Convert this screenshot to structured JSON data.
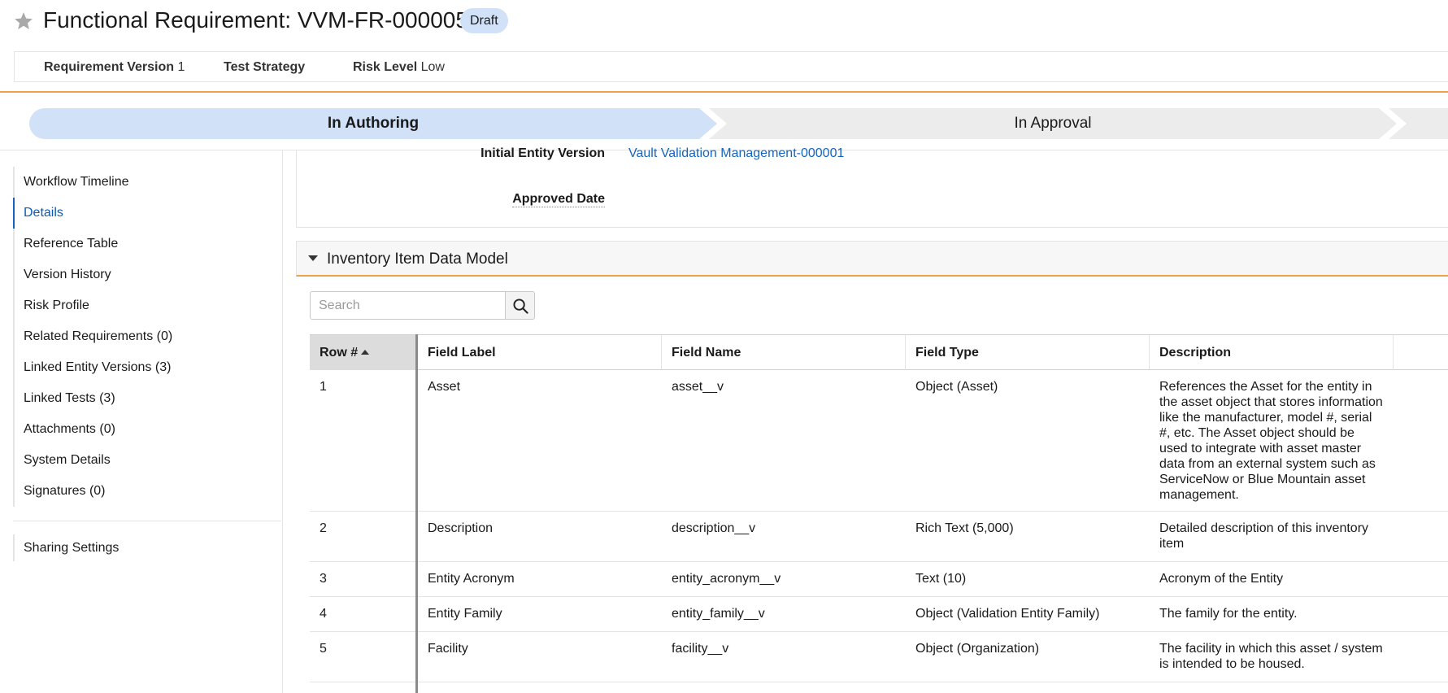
{
  "header": {
    "title": "Functional Requirement: VVM-FR-000005",
    "status_badge": "Draft",
    "star_icon": "star-icon"
  },
  "attributes": [
    {
      "label": "Requirement Version",
      "value": "1"
    },
    {
      "label": "Test Strategy",
      "value": ""
    },
    {
      "label": "Risk Level",
      "value": "Low"
    }
  ],
  "workflow": {
    "stages": [
      {
        "label": "In Authoring",
        "active": true
      },
      {
        "label": "In Approval",
        "active": false
      }
    ]
  },
  "sidebar": {
    "items": [
      {
        "label": "Workflow Timeline"
      },
      {
        "label": "Details"
      },
      {
        "label": "Reference Table"
      },
      {
        "label": "Version History"
      },
      {
        "label": "Risk Profile"
      },
      {
        "label": "Related Requirements (0)"
      },
      {
        "label": "Linked Entity Versions (3)"
      },
      {
        "label": "Linked Tests (3)"
      },
      {
        "label": "Attachments (0)"
      },
      {
        "label": "System Details"
      },
      {
        "label": "Signatures (0)"
      }
    ],
    "active_item": "Details",
    "sharing_settings": "Sharing Settings"
  },
  "details": {
    "initial_entity_version_label": "Initial Entity Version",
    "initial_entity_version_value": "Vault Validation Management-000001",
    "approved_date_label": "Approved Date",
    "approved_date_value": ""
  },
  "section": {
    "title": "Inventory Item Data Model",
    "search_placeholder": "Search"
  },
  "table": {
    "columns": [
      "Row #",
      "Field Label",
      "Field Name",
      "Field Type",
      "Description"
    ],
    "rows": [
      {
        "row": "1",
        "field_label": "Asset",
        "field_name": "asset__v",
        "field_type": "Object (Asset)",
        "description": "References the Asset for the entity in the asset object that stores information like the manufacturer, model #, serial #, etc. The Asset object should be used to integrate with asset master data from an external system such as ServiceNow or Blue Mountain asset management."
      },
      {
        "row": "2",
        "field_label": "Description",
        "field_name": "description__v",
        "field_type": "Rich Text (5,000)",
        "description": "Detailed description of this inventory item"
      },
      {
        "row": "3",
        "field_label": "Entity Acronym",
        "field_name": "entity_acronym__v",
        "field_type": "Text (10)",
        "description": "Acronym of the Entity"
      },
      {
        "row": "4",
        "field_label": "Entity Family",
        "field_name": "entity_family__v",
        "field_type": "Object (Validation Entity Family)",
        "description": "The family for the entity."
      },
      {
        "row": "5",
        "field_label": "Facility",
        "field_name": "facility__v",
        "field_type": "Object (Organization)",
        "description": "The facility in which this asset / system is intended to be housed."
      }
    ]
  },
  "colors": {
    "accent_orange": "#f0a04b",
    "active_stage": "#d1e1f7",
    "inactive_stage": "#ececec",
    "link_blue": "#1565c0",
    "badge_bg": "#d1e1f7"
  }
}
